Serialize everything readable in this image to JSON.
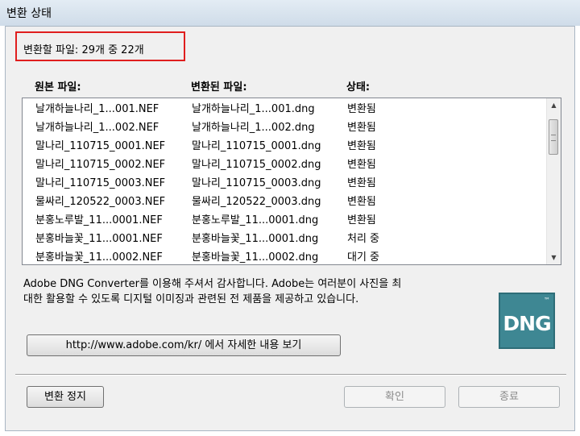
{
  "window": {
    "title": "변환 상태"
  },
  "status": {
    "text": "변환할 파일: 29개 중 22개"
  },
  "columns": {
    "original": "원본 파일:",
    "converted": "변환된 파일:",
    "state": "상태:"
  },
  "files": [
    {
      "original": "날개하늘나리_1...001.NEF",
      "converted": "날개하늘나리_1...001.dng",
      "state": "변환됨"
    },
    {
      "original": "날개하늘나리_1...002.NEF",
      "converted": "날개하늘나리_1...002.dng",
      "state": "변환됨"
    },
    {
      "original": "말나리_110715_0001.NEF",
      "converted": "말나리_110715_0001.dng",
      "state": "변환됨"
    },
    {
      "original": "말나리_110715_0002.NEF",
      "converted": "말나리_110715_0002.dng",
      "state": "변환됨"
    },
    {
      "original": "말나리_110715_0003.NEF",
      "converted": "말나리_110715_0003.dng",
      "state": "변환됨"
    },
    {
      "original": "물싸리_120522_0003.NEF",
      "converted": "물싸리_120522_0003.dng",
      "state": "변환됨"
    },
    {
      "original": "분홍노루발_11...0001.NEF",
      "converted": "분홍노루발_11...0001.dng",
      "state": "변환됨"
    },
    {
      "original": "분홍바늘꽃_11...0001.NEF",
      "converted": "분홍바늘꽃_11...0001.dng",
      "state": "처리 중"
    },
    {
      "original": "분홍바늘꽃_11...0002.NEF",
      "converted": "분홍바늘꽃_11...0002.dng",
      "state": "대기 중"
    }
  ],
  "info": {
    "line1": "Adobe DNG Converter를 이용해 주셔서 감사합니다. Adobe는 여러분이 사진을 최",
    "line2": "대한 활용할 수 있도록 디지털 이미징과 관련된 전 제품을 제공하고 있습니다."
  },
  "logo": {
    "text": "DNG",
    "mark": "™"
  },
  "buttons": {
    "website": "http://www.adobe.com/kr/ 에서 자세한 내용 보기",
    "stop": "변환 정지",
    "ok": "확인",
    "quit": "종료"
  },
  "icons": {
    "scroll_up": "scroll-up-arrow-icon",
    "scroll_down": "scroll-down-arrow-icon"
  }
}
